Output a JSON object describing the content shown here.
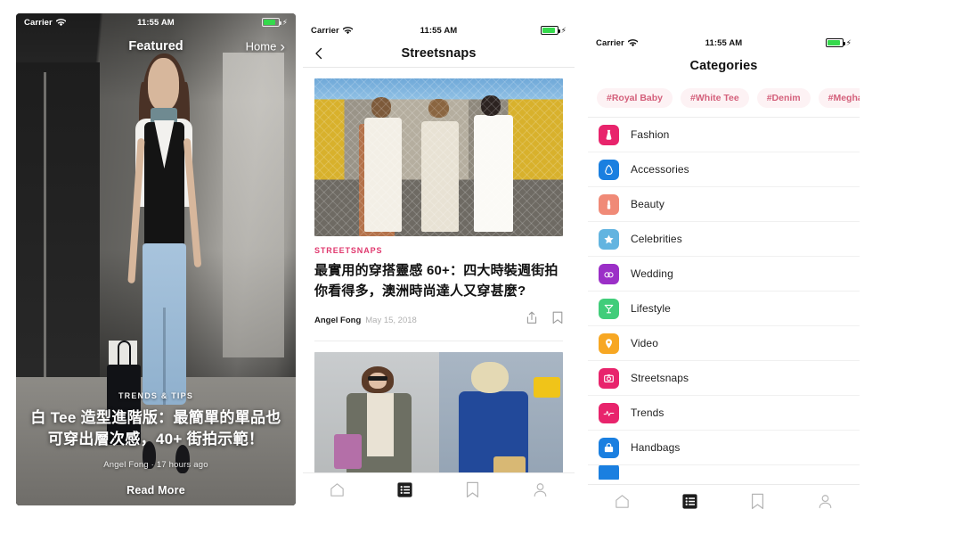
{
  "panels": {
    "featured": {
      "status": {
        "carrier": "Carrier",
        "time": "11:55 AM"
      },
      "nav": {
        "title": "Featured",
        "home_label": "Home"
      },
      "card": {
        "kicker": "TRENDS & TIPS",
        "headline": "白 Tee 造型進階版：最簡單的單品也可穿出層次感，40+ 街拍示範！",
        "author": "Angel Fong",
        "time_ago": "17 hours ago",
        "read_more": "Read More"
      }
    },
    "streetsnaps": {
      "status": {
        "carrier": "Carrier",
        "time": "11:55 AM"
      },
      "nav": {
        "title": "Streetsnaps",
        "back_icon": "chevron-left-icon"
      },
      "articles": [
        {
          "kicker": "STREETSNAPS",
          "title": "最實用的穿搭靈感 60+：四大時裝週街拍你看得多，澳洲時尚達人又穿甚麼?",
          "author": "Angel Fong",
          "date": "May 15, 2018",
          "share_icon": "share-icon",
          "bookmark_icon": "bookmark-icon"
        },
        {
          "kicker": "",
          "title": "",
          "author": "",
          "date": ""
        }
      ],
      "tabbar": [
        {
          "name": "home",
          "icon": "home-icon",
          "active": false
        },
        {
          "name": "categories",
          "icon": "list-icon",
          "active": true
        },
        {
          "name": "bookmarks",
          "icon": "bookmark-icon",
          "active": false
        },
        {
          "name": "profile",
          "icon": "person-icon",
          "active": false
        }
      ]
    },
    "categories": {
      "status": {
        "carrier": "Carrier",
        "time": "11:55 AM"
      },
      "nav": {
        "title": "Categories"
      },
      "tags": [
        "#Royal Baby",
        "#White Tee",
        "#Denim",
        "#Meghan Mar"
      ],
      "items": [
        {
          "label": "Fashion",
          "icon": "dress-icon",
          "color": "#e8246c"
        },
        {
          "label": "Accessories",
          "icon": "gem-icon",
          "color": "#1a7fe0"
        },
        {
          "label": "Beauty",
          "icon": "lipstick-icon",
          "color": "#f08a77"
        },
        {
          "label": "Celebrities",
          "icon": "star-icon",
          "color": "#62b4e0"
        },
        {
          "label": "Wedding",
          "icon": "rings-icon",
          "color": "#9b2fc7"
        },
        {
          "label": "Lifestyle",
          "icon": "cocktail-icon",
          "color": "#41cd7a"
        },
        {
          "label": "Video",
          "icon": "location-icon",
          "color": "#f7a723"
        },
        {
          "label": "Streetsnaps",
          "icon": "camera-icon",
          "color": "#e8246c"
        },
        {
          "label": "Trends",
          "icon": "pulse-icon",
          "color": "#e8246c"
        },
        {
          "label": "Handbags",
          "icon": "handbag-icon",
          "color": "#1a7fe0"
        }
      ],
      "tabbar": [
        {
          "name": "home",
          "icon": "home-icon",
          "active": false
        },
        {
          "name": "categories",
          "icon": "list-icon",
          "active": true
        },
        {
          "name": "bookmarks",
          "icon": "bookmark-icon",
          "active": false
        },
        {
          "name": "profile",
          "icon": "person-icon",
          "active": false
        }
      ]
    }
  },
  "colors": {
    "accent_pink": "#e0386e",
    "tag_bg": "#fdf2f4",
    "tag_text": "#d4607b",
    "battery_green": "#35d94c"
  }
}
